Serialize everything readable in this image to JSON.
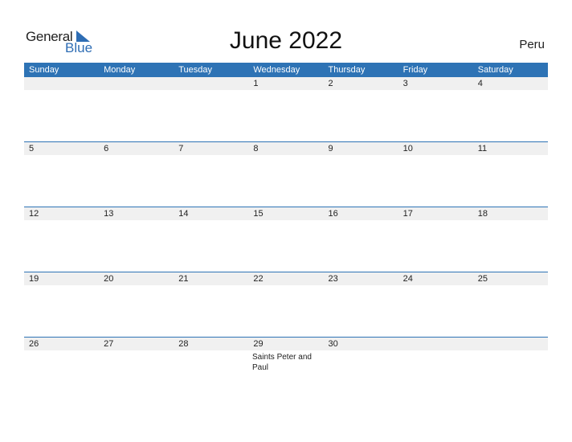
{
  "logo": {
    "general": "General",
    "blue": "Blue"
  },
  "title": "June 2022",
  "country": "Peru",
  "days": [
    "Sunday",
    "Monday",
    "Tuesday",
    "Wednesday",
    "Thursday",
    "Friday",
    "Saturday"
  ],
  "weeks": [
    [
      "",
      "",
      "",
      "1",
      "2",
      "3",
      "4"
    ],
    [
      "5",
      "6",
      "7",
      "8",
      "9",
      "10",
      "11"
    ],
    [
      "12",
      "13",
      "14",
      "15",
      "16",
      "17",
      "18"
    ],
    [
      "19",
      "20",
      "21",
      "22",
      "23",
      "24",
      "25"
    ],
    [
      "26",
      "27",
      "28",
      "29",
      "30",
      "",
      ""
    ]
  ],
  "events": [
    {
      "date": "29",
      "label": "Saints Peter and Paul"
    }
  ]
}
